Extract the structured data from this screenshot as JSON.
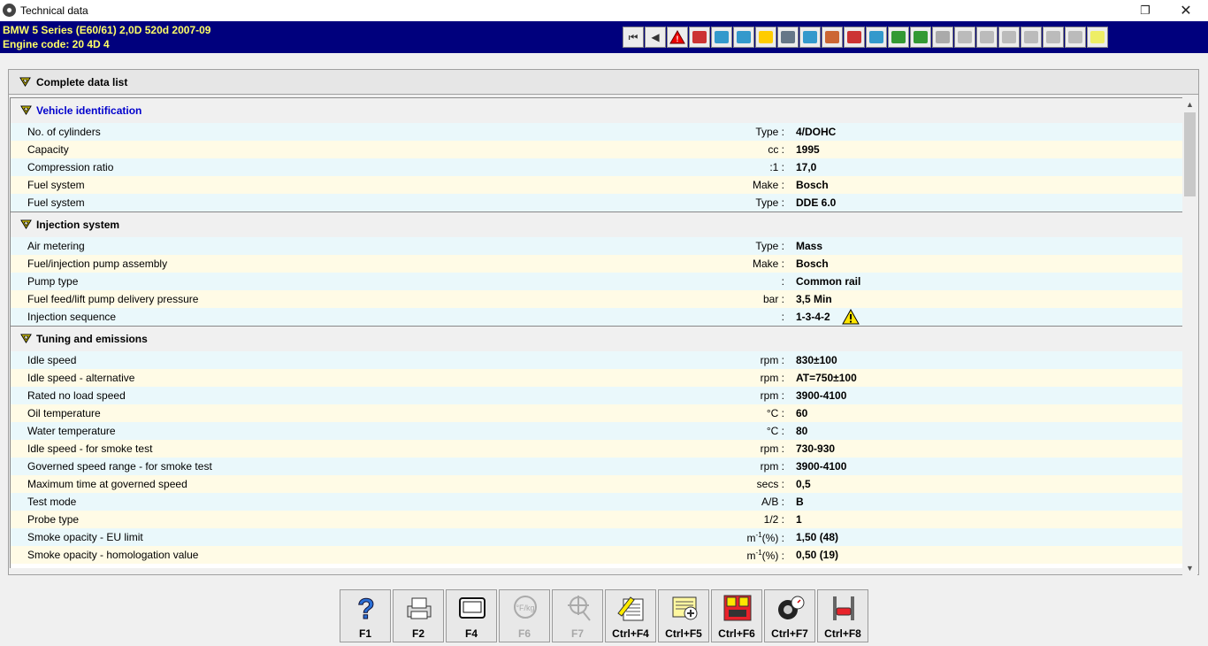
{
  "window": {
    "title": "Technical data"
  },
  "header": {
    "line1": "BMW   5 Series (E60/61) 2,0D 520d 2007-09",
    "line2": "Engine code: 20 4D 4"
  },
  "complete_list_label": "Complete data list",
  "sections": [
    {
      "title": "Vehicle identification",
      "rows": [
        {
          "label": "No. of cylinders",
          "unit": "Type :",
          "value": "4/DOHC"
        },
        {
          "label": "Capacity",
          "unit": "cc :",
          "value": "1995"
        },
        {
          "label": "Compression ratio",
          "unit": ":1 :",
          "value": "17,0"
        },
        {
          "label": "Fuel system",
          "unit": "Make :",
          "value": "Bosch"
        },
        {
          "label": "Fuel system",
          "unit": "Type :",
          "value": "DDE 6.0"
        }
      ]
    },
    {
      "title": "Injection system",
      "rows": [
        {
          "label": "Air metering",
          "unit": "Type :",
          "value": "Mass"
        },
        {
          "label": "Fuel/injection pump assembly",
          "unit": "Make :",
          "value": "Bosch"
        },
        {
          "label": "Pump type",
          "unit": ":",
          "value": "Common rail"
        },
        {
          "label": "Fuel feed/lift pump delivery pressure",
          "unit": "bar :",
          "value": "3,5 Min"
        },
        {
          "label": "Injection sequence",
          "unit": ":",
          "value": "1-3-4-2"
        }
      ]
    },
    {
      "title": "Tuning and emissions",
      "rows": [
        {
          "label": "Idle speed",
          "unit": "rpm :",
          "value": "830±100"
        },
        {
          "label": "Idle speed - alternative",
          "unit": "rpm :",
          "value": "AT=750±100"
        },
        {
          "label": "Rated no load speed",
          "unit": "rpm :",
          "value": "3900-4100"
        },
        {
          "label": "Oil temperature",
          "unit": "°C :",
          "value": "60"
        },
        {
          "label": "Water temperature",
          "unit": "°C :",
          "value": "80"
        },
        {
          "label": "Idle speed - for smoke test",
          "unit": "rpm :",
          "value": "730-930"
        },
        {
          "label": "Governed speed range - for smoke test",
          "unit": "rpm :",
          "value": "3900-4100"
        },
        {
          "label": "Maximum time at governed speed",
          "unit": "secs :",
          "value": "0,5"
        },
        {
          "label": "Test mode",
          "unit": "A/B :",
          "value": "B"
        },
        {
          "label": "Probe type",
          "unit": "1/2 :",
          "value": "1"
        },
        {
          "label": "Smoke opacity - EU limit",
          "unit": "m-1(%) :",
          "value": "1,50 (48)"
        },
        {
          "label": "Smoke opacity - homologation value",
          "unit": "m-1(%) :",
          "value": "0,50 (19)"
        }
      ]
    }
  ],
  "fkeys": [
    {
      "label": "F1",
      "icon": "help-icon",
      "enabled": true
    },
    {
      "label": "F2",
      "icon": "printer-icon",
      "enabled": true
    },
    {
      "label": "F4",
      "icon": "screen-icon",
      "enabled": true
    },
    {
      "label": "F6",
      "icon": "units-icon",
      "enabled": false
    },
    {
      "label": "F7",
      "icon": "search-icon",
      "enabled": false
    },
    {
      "label": "Ctrl+F4",
      "icon": "notes-icon",
      "enabled": true
    },
    {
      "label": "Ctrl+F5",
      "icon": "add-note-icon",
      "enabled": true
    },
    {
      "label": "Ctrl+F6",
      "icon": "numbered-icon",
      "enabled": true
    },
    {
      "label": "Ctrl+F7",
      "icon": "tyre-gauge-icon",
      "enabled": true
    },
    {
      "label": "Ctrl+F8",
      "icon": "vehicle-lift-icon",
      "enabled": true
    }
  ],
  "toolbar_icons": [
    "first-page-icon",
    "previous-page-icon",
    "warning-icon",
    "ecu-icon",
    "service-icon",
    "timing-icon",
    "torque-icon",
    "wheel-icon",
    "electrical-icon",
    "ac-icon",
    "repair-icon",
    "mechanic-icon",
    "battery-icon",
    "diagnostic-icon",
    "cooling-icon",
    "disabled-a-icon",
    "disabled-b-icon",
    "disabled-c-icon",
    "disabled-d-icon",
    "disabled-e-icon",
    "disabled-f-icon",
    "info-icon"
  ]
}
